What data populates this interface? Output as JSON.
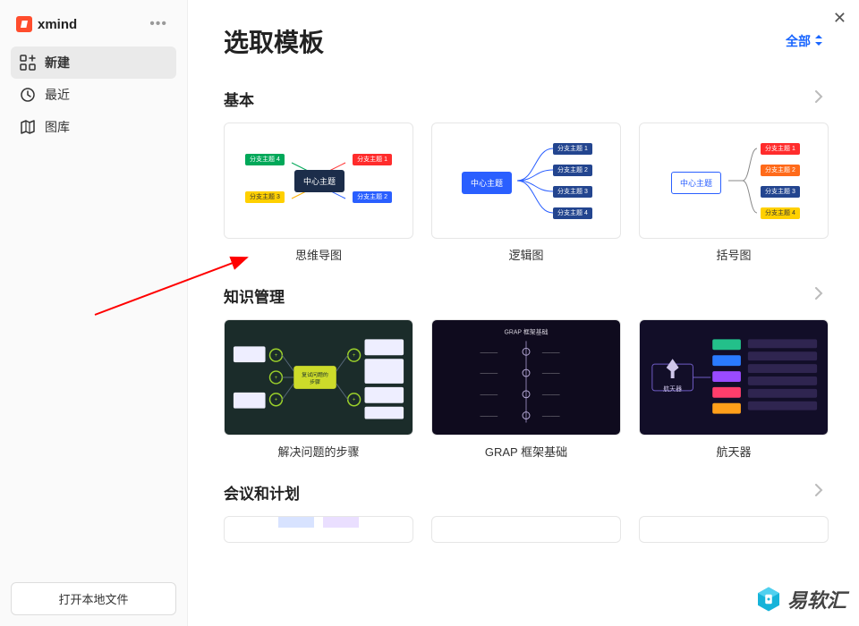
{
  "brand": {
    "name": "xmind"
  },
  "sidebar": {
    "items": [
      {
        "label": "新建",
        "active": true
      },
      {
        "label": "最近",
        "active": false
      },
      {
        "label": "图库",
        "active": false
      }
    ],
    "open_local": "打开本地文件"
  },
  "main": {
    "title": "选取模板",
    "filter_label": "全部"
  },
  "sections": [
    {
      "title": "基本",
      "cards": [
        {
          "label": "思维导图"
        },
        {
          "label": "逻辑图"
        },
        {
          "label": "括号图"
        }
      ]
    },
    {
      "title": "知识管理",
      "cards": [
        {
          "label": "解决问题的步骤"
        },
        {
          "label": "GRAP 框架基础"
        },
        {
          "label": "航天器"
        }
      ]
    },
    {
      "title": "会议和计划",
      "cards": []
    }
  ],
  "nodes": {
    "center": "中心主题",
    "b1": "分支主题 1",
    "b2": "分支主题 2",
    "b3": "分支主题 3",
    "b4": "分支主题 4"
  },
  "thumbs": {
    "km1_center": "复试问题的步骤",
    "km2_title": "GRAP 框架基础",
    "km3_center": "航天器"
  },
  "watermark": "易软汇"
}
